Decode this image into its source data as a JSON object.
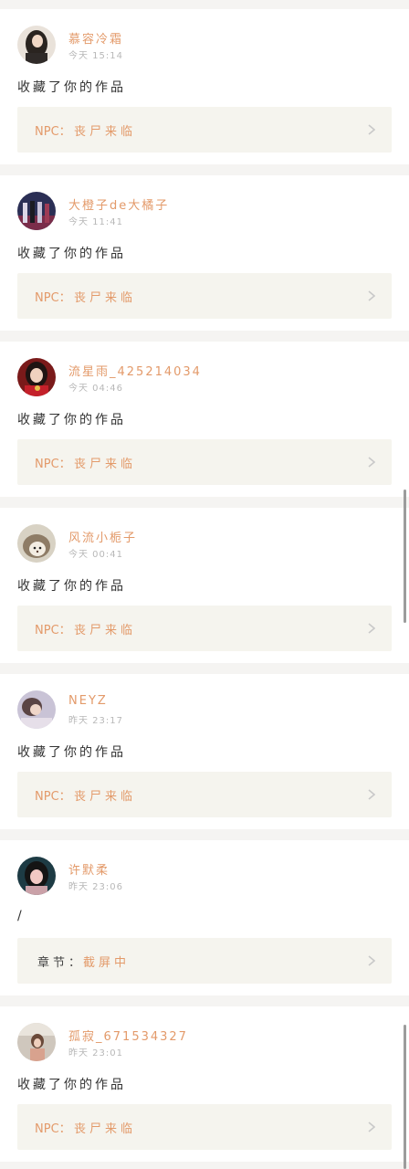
{
  "feed": {
    "items": [
      {
        "username": "慕容冷霜",
        "time": "今天 15:14",
        "action": "收藏了你的作品",
        "work_prefix": "NPC：",
        "work_title": "丧尸来临",
        "avatar_icon": "avatar-girl-dark-hair"
      },
      {
        "username": "大橙子de大橘子",
        "time": "今天 11:41",
        "action": "收藏了你的作品",
        "work_prefix": "NPC：",
        "work_title": "丧尸来临",
        "avatar_icon": "avatar-group-photo"
      },
      {
        "username": "流星雨_425214034",
        "time": "今天 04:46",
        "action": "收藏了你的作品",
        "work_prefix": "NPC：",
        "work_title": "丧尸来临",
        "avatar_icon": "avatar-girl-red"
      },
      {
        "username": "风流小栀子",
        "time": "今天 00:41",
        "action": "收藏了你的作品",
        "work_prefix": "NPC：",
        "work_title": "丧尸来临",
        "avatar_icon": "avatar-hedgehog"
      },
      {
        "username": "NEYZ",
        "time": "昨天 23:17",
        "action": "收藏了你的作品",
        "work_prefix": "NPC：",
        "work_title": "丧尸来临",
        "avatar_icon": "avatar-girl-lying"
      },
      {
        "username": "许默柔",
        "time": "昨天 23:06",
        "action": "/",
        "work_prefix": "章节：",
        "work_title": "截屏中",
        "avatar_icon": "avatar-girl-dark"
      },
      {
        "username": "孤寂_671534327",
        "time": "昨天 23:01",
        "action": "收藏了你的作品",
        "work_prefix": "NPC：",
        "work_title": "丧尸来临",
        "avatar_icon": "avatar-girl-street"
      }
    ]
  },
  "colors": {
    "accent": "#e39a6a",
    "card_background": "#ffffff",
    "page_background": "#f5f4f2",
    "work_box_background": "#f5f4ee",
    "timestamp": "#b8b8b8",
    "body_text": "#333333"
  },
  "icons": {
    "chevron": "chevron-right-icon"
  }
}
